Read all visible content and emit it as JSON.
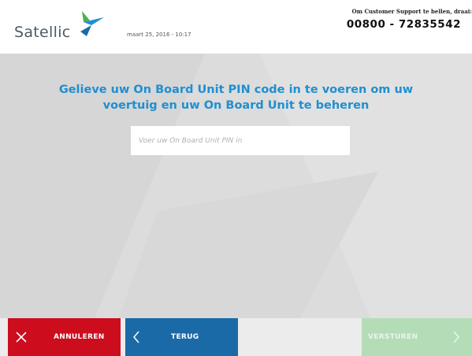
{
  "header": {
    "logo_text": "Satellic",
    "datetime": "maart 25, 2016 - 10:17",
    "support_label": "Om Customer Support te bellen, draai:",
    "support_phone": "00800 - 72835542"
  },
  "main": {
    "instruction_line1": "Gelieve uw On Board Unit PIN code in te voeren om uw",
    "instruction_line2": "voertuig en uw On Board Unit te beheren",
    "pin_placeholder": "Voer uw On Board Unit PIN in",
    "pin_value": ""
  },
  "footer": {
    "cancel_label": "ANNULEREN",
    "back_label": "TERUG",
    "send_label": "VERSTUREN"
  },
  "icons": {
    "logo": "satellic-logo-icon",
    "cancel": "close-icon",
    "back": "chevron-left-icon",
    "send": "chevron-right-icon"
  },
  "colors": {
    "accent_blue": "#1f8fd0",
    "cancel_red": "#cc0d1e",
    "back_blue": "#1b6aa8",
    "send_disabled_green": "#b4ddb7",
    "main_bg": "#dcdcdc"
  }
}
